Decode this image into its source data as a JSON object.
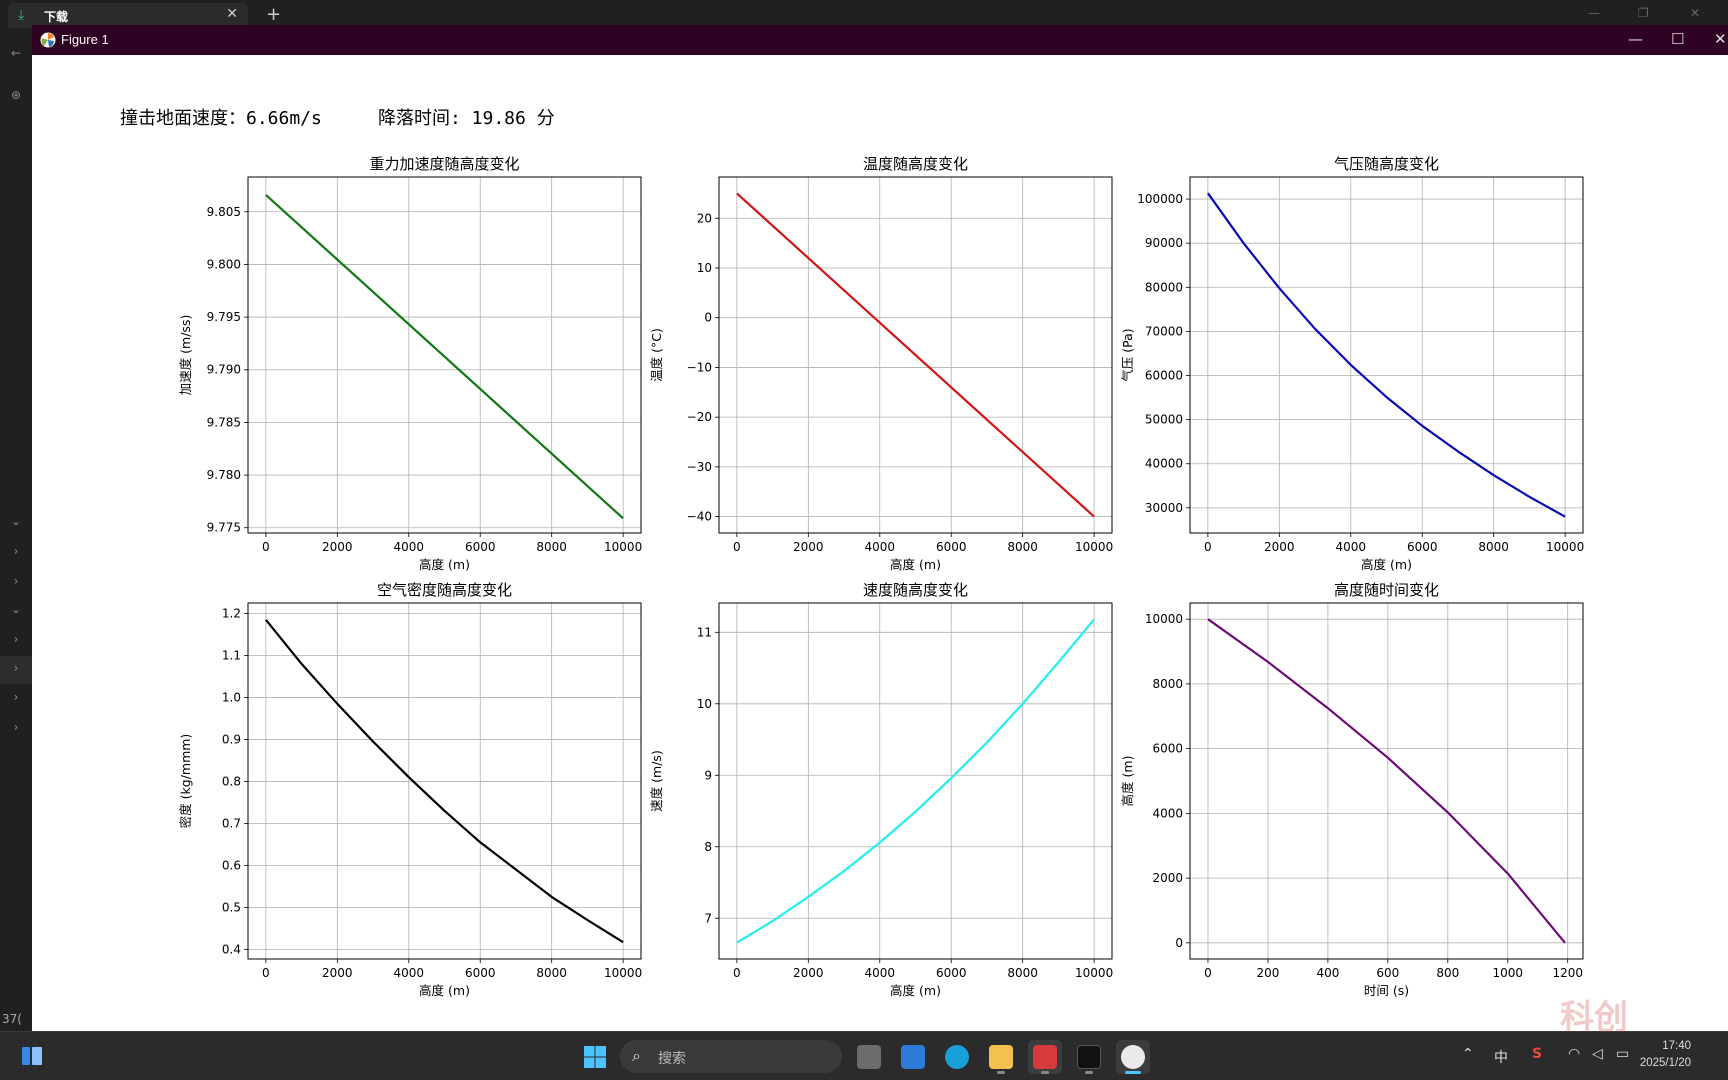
{
  "browser": {
    "tab_label": "下载",
    "tab_close": "✕",
    "new_tab": "+"
  },
  "left_panel": {
    "bottom_text": "37("
  },
  "figure": {
    "window_title": "Figure 1",
    "min": "—",
    "max": "☐",
    "close": "✕",
    "impact_speed": "撞击地面速度：6.66m/s",
    "descent_time": "降落时间: 19.86 分"
  },
  "taskbar": {
    "search_placeholder": "搜索",
    "ime": "中",
    "time": "17:40",
    "date": "2025/1/20",
    "watermark": "科创"
  },
  "colors": {
    "gravity": "#137713",
    "temperature": "#d21414",
    "pressure": "#0a0ab4",
    "density": "#000000",
    "velocity": "#22eeee",
    "altitude": "#6e0a78",
    "titlebar": "#2f0224"
  },
  "chart_data": [
    {
      "type": "line",
      "title": "重力加速度随高度变化",
      "xlabel": "高度 (m)",
      "ylabel": "加速度 (m/ss)",
      "xlim": [
        -500,
        10500
      ],
      "ylim": [
        9.7745,
        9.8083
      ],
      "xticks": [
        "0",
        "2000",
        "4000",
        "6000",
        "8000",
        "10000"
      ],
      "yticks": [
        "9.775",
        "9.780",
        "9.785",
        "9.790",
        "9.795",
        "9.800",
        "9.805"
      ],
      "grid": true,
      "x": [
        0,
        10000
      ],
      "y": [
        9.8066,
        9.7759
      ]
    },
    {
      "type": "line",
      "title": "温度随高度变化",
      "xlabel": "高度 (m)",
      "ylabel": "温度 (°C)",
      "xlim": [
        -500,
        10500
      ],
      "ylim": [
        -43.3,
        28.3
      ],
      "xticks": [
        "0",
        "2000",
        "4000",
        "6000",
        "8000",
        "10000"
      ],
      "yticks": [
        "−40",
        "−30",
        "−20",
        "−10",
        "0",
        "10",
        "20"
      ],
      "grid": true,
      "x": [
        0,
        10000
      ],
      "y": [
        25,
        -40
      ]
    },
    {
      "type": "line",
      "title": "气压随高度变化",
      "xlabel": "高度 (m)",
      "ylabel": "气压 (Pa)",
      "xlim": [
        -500,
        10500
      ],
      "ylim": [
        24300,
        105000
      ],
      "xticks": [
        "0",
        "2000",
        "4000",
        "6000",
        "8000",
        "10000"
      ],
      "yticks": [
        "30000",
        "40000",
        "50000",
        "60000",
        "70000",
        "80000",
        "90000",
        "100000"
      ],
      "grid": true,
      "x": [
        0,
        1000,
        2000,
        3000,
        4000,
        5000,
        6000,
        7000,
        8000,
        9000,
        10000
      ],
      "y": [
        101325,
        90000,
        79800,
        70600,
        62400,
        55100,
        48600,
        42800,
        37400,
        32500,
        28000
      ]
    },
    {
      "type": "line",
      "title": "空气密度随高度变化",
      "xlabel": "高度 (m)",
      "ylabel": "密度 (kg/mmm)",
      "xlim": [
        -500,
        10500
      ],
      "ylim": [
        0.377,
        1.225
      ],
      "xticks": [
        "0",
        "2000",
        "4000",
        "6000",
        "8000",
        "10000"
      ],
      "yticks": [
        "0.4",
        "0.5",
        "0.6",
        "0.7",
        "0.8",
        "0.9",
        "1.0",
        "1.1",
        "1.2"
      ],
      "grid": true,
      "x": [
        0,
        1000,
        2000,
        3000,
        4000,
        5000,
        6000,
        7000,
        8000,
        9000,
        10000
      ],
      "y": [
        1.185,
        1.08,
        0.985,
        0.895,
        0.81,
        0.73,
        0.655,
        0.59,
        0.525,
        0.47,
        0.417
      ]
    },
    {
      "type": "line",
      "title": "速度随高度变化",
      "xlabel": "高度 (m)",
      "ylabel": "速度 (m/s)",
      "xlim": [
        -500,
        10500
      ],
      "ylim": [
        6.43,
        11.41
      ],
      "xticks": [
        "0",
        "2000",
        "4000",
        "6000",
        "8000",
        "10000"
      ],
      "yticks": [
        "7",
        "8",
        "9",
        "10",
        "11"
      ],
      "grid": true,
      "x": [
        0,
        1000,
        2000,
        3000,
        4000,
        5000,
        6000,
        7000,
        8000,
        9000,
        10000
      ],
      "y": [
        6.66,
        6.96,
        7.3,
        7.66,
        8.06,
        8.49,
        8.96,
        9.46,
        10.0,
        10.58,
        11.18
      ]
    },
    {
      "type": "line",
      "title": "高度随时间变化",
      "xlabel": "时间 (s)",
      "ylabel": "高度 (m)",
      "xlim": [
        -60,
        1251
      ],
      "ylim": [
        -500,
        10500
      ],
      "xticks": [
        "0",
        "200",
        "400",
        "600",
        "800",
        "1000",
        "1200"
      ],
      "yticks": [
        "0",
        "2000",
        "4000",
        "6000",
        "8000",
        "10000"
      ],
      "grid": true,
      "x": [
        0,
        200,
        400,
        600,
        800,
        1000,
        1191
      ],
      "y": [
        10000,
        8680,
        7250,
        5720,
        4030,
        2140,
        0
      ]
    }
  ]
}
